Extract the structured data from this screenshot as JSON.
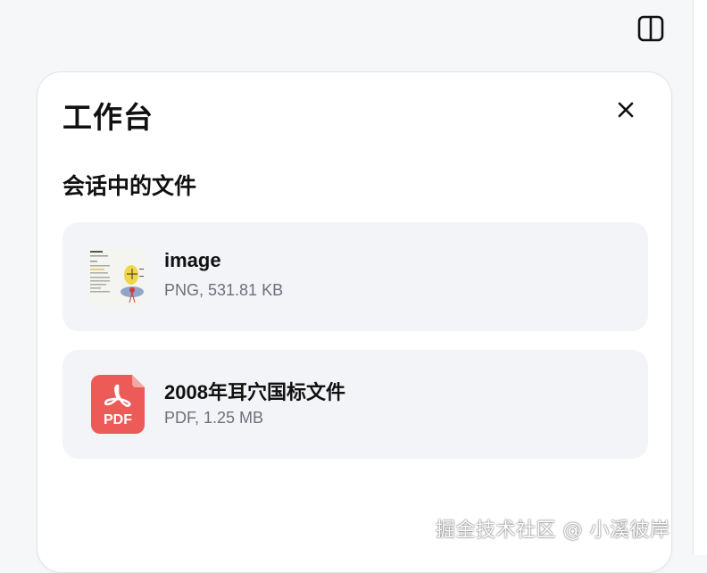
{
  "panel": {
    "title": "工作台",
    "section_heading": "会话中的文件"
  },
  "files": [
    {
      "name": "image",
      "meta": "PNG, 531.81 KB",
      "icon": "image-thumbnail"
    },
    {
      "name": "2008年耳穴国标文件",
      "meta": "PDF, 1.25 MB",
      "icon": "pdf-file-icon",
      "icon_label": "PDF"
    }
  ],
  "watermark": "掘金技术社区 @ 小溪彼岸",
  "icons": {
    "sidebar_toggle": "sidebar-toggle-icon",
    "close": "close-icon"
  },
  "colors": {
    "pdf_red": "#ec5b57",
    "card_bg": "#f3f4f8",
    "meta_gray": "#6e7079"
  }
}
